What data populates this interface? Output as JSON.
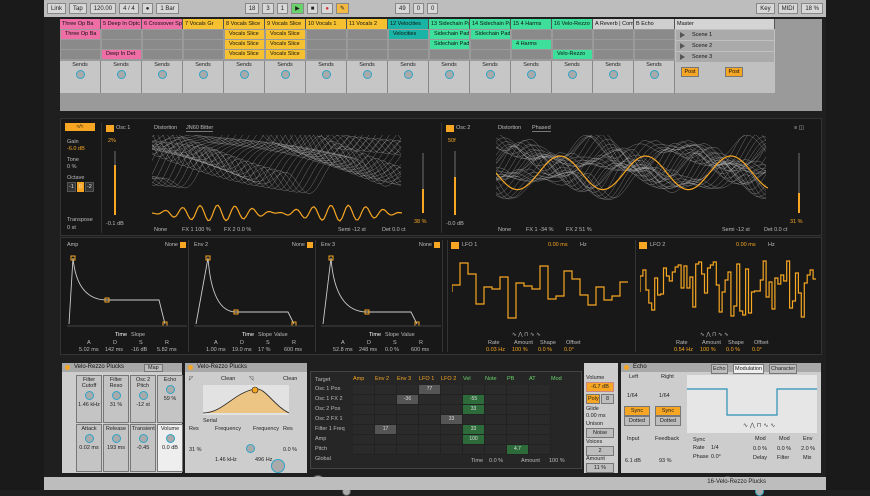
{
  "transport": {
    "link": "Link",
    "tap": "Tap",
    "tempo": "120.00",
    "sig": "4 / 4",
    "quant": "1 Bar",
    "bar": "18",
    "beat": "3",
    "beat2": "1",
    "pos": "49",
    "pos2": "0",
    "pos3": "0",
    "key": "Key",
    "midi": "MIDI",
    "cpu": "18 %"
  },
  "tracks": [
    {
      "name": "Three Op Ba",
      "color": "#f06ea6",
      "clips": [
        {
          "t": "Three Op Ba",
          "c": "#f06ea6"
        },
        {
          "t": "",
          "c": ""
        },
        {
          "t": "",
          "c": ""
        }
      ]
    },
    {
      "name": "5 Deep In Optc",
      "color": "#f06ea6",
      "clips": [
        {
          "t": "",
          "c": ""
        },
        {
          "t": "",
          "c": ""
        },
        {
          "t": "Deep In Det",
          "c": "#f06ea6"
        }
      ]
    },
    {
      "name": "6 Crossover Sp",
      "color": "#f06ea6",
      "clips": [
        {
          "t": "",
          "c": ""
        },
        {
          "t": "",
          "c": ""
        },
        {
          "t": "",
          "c": ""
        }
      ]
    },
    {
      "name": "7 Vocals Gr",
      "color": "#f6c130",
      "clips": [
        {
          "t": "",
          "c": ""
        },
        {
          "t": "",
          "c": ""
        },
        {
          "t": "",
          "c": ""
        }
      ]
    },
    {
      "name": "8 Vocals Slice",
      "color": "#f6c130",
      "clips": [
        {
          "t": "Vocals Slice",
          "c": "#f6c130"
        },
        {
          "t": "Vocals Slice",
          "c": "#f6c130"
        },
        {
          "t": "Vocals Slice",
          "c": "#f6c130"
        }
      ]
    },
    {
      "name": "9 Vocals Slice",
      "color": "#f6c130",
      "clips": [
        {
          "t": "Vocals Slice",
          "c": "#f6c130"
        },
        {
          "t": "Vocals Slice",
          "c": "#f6c130"
        },
        {
          "t": "Vocals Slice",
          "c": "#f6c130"
        }
      ]
    },
    {
      "name": "10 Vocals 1",
      "color": "#f6c130",
      "clips": [
        {
          "t": "",
          "c": ""
        },
        {
          "t": "",
          "c": ""
        },
        {
          "t": "",
          "c": ""
        }
      ]
    },
    {
      "name": "11 Vocals 2",
      "color": "#f6c130",
      "clips": [
        {
          "t": "",
          "c": ""
        },
        {
          "t": "",
          "c": ""
        },
        {
          "t": "",
          "c": ""
        }
      ]
    },
    {
      "name": "12 Velocities",
      "color": "#19b4a6",
      "clips": [
        {
          "t": "Velocities",
          "c": "#19b4a6"
        },
        {
          "t": "",
          "c": ""
        },
        {
          "t": "",
          "c": ""
        }
      ]
    },
    {
      "name": "13 Sidechain Pad",
      "color": "#3ddf9a",
      "clips": [
        {
          "t": "Sidechain Pad",
          "c": "#3ddf9a"
        },
        {
          "t": "Sidechain Pad",
          "c": "#3ddf9a"
        },
        {
          "t": "",
          "c": ""
        }
      ]
    },
    {
      "name": "14 Sidechain Pad",
      "color": "#3ddf9a",
      "clips": [
        {
          "t": "Sidechain Pad",
          "c": "#3ddf9a"
        },
        {
          "t": "",
          "c": ""
        },
        {
          "t": "",
          "c": ""
        }
      ]
    },
    {
      "name": "15 4 Harms",
      "color": "#3ddf9a",
      "clips": [
        {
          "t": "",
          "c": ""
        },
        {
          "t": "4 Harms",
          "c": "#3ddf9a"
        },
        {
          "t": "",
          "c": ""
        }
      ]
    },
    {
      "name": "16 Velo-Rezzo",
      "color": "#3ddf9a",
      "clips": [
        {
          "t": "",
          "c": ""
        },
        {
          "t": "",
          "c": ""
        },
        {
          "t": "Velo-Rezzo",
          "c": "#3ddf9a"
        }
      ]
    },
    {
      "name": "A Reverb | Compre",
      "color": "#cfcfcf",
      "clips": [
        {
          "t": "",
          "c": ""
        },
        {
          "t": "",
          "c": ""
        },
        {
          "t": "",
          "c": ""
        }
      ]
    },
    {
      "name": "B Echo",
      "color": "#cfcfcf",
      "clips": [
        {
          "t": "",
          "c": ""
        },
        {
          "t": "",
          "c": ""
        },
        {
          "t": "",
          "c": ""
        }
      ]
    }
  ],
  "master": {
    "name": "Master",
    "scenes": [
      "Scene 1",
      "Scene 2",
      "Scene 3"
    ],
    "post1": "Post",
    "post2": "Post"
  },
  "sends_label": "Sends",
  "osc1": {
    "label": "Osc 1",
    "dist_label": "Distortion",
    "dist_val": "JN60 Bitter",
    "gain_label": "Gain",
    "gain": "-6.0 dB",
    "tone_label": "Tone",
    "tone": "0 %",
    "octave_label": "Octave",
    "oct": [
      "-1",
      "0",
      "-2"
    ],
    "transpose_label": "Transpose",
    "transpose": "0 st",
    "level": "2%",
    "db": "-0.1 dB",
    "fx1": "FX 1 100 %",
    "fx2": "FX 2 0.0 %",
    "none": "None",
    "semi": "Semi -12 st",
    "det": "Det 0.0 ct",
    "pct": "38 %"
  },
  "osc2": {
    "label": "Osc 2",
    "dist_label": "Distortion",
    "dist_val": "Phased",
    "level": "50f",
    "db": "-0.0 dB",
    "fx1": "FX 1 -34 %",
    "fx2": "FX 2 51 %",
    "none": "None",
    "semi": "Semi -12 st",
    "det": "Det 0.0 ct",
    "pct": "31 %"
  },
  "env": [
    {
      "name": "Amp",
      "mode": "None",
      "time": "Time",
      "slope": "Slope",
      "a": "5.02 ms",
      "d": "142 ms",
      "s": "-16 dB",
      "r": "5.82 ms"
    },
    {
      "name": "Env 2",
      "mode": "None",
      "time": "Time",
      "slope": "Slope",
      "value": "Value",
      "a": "1.00 ms",
      "d": "19.0 ms",
      "s": "17 %",
      "r": "600 ms"
    },
    {
      "name": "Env 3",
      "mode": "None",
      "time": "Time",
      "slope": "Slope",
      "value": "Value",
      "a": "52.8 ms",
      "d": "248 ms",
      "s": "0.0 %",
      "r": "600 ms"
    }
  ],
  "adsr_labels": [
    "A",
    "D",
    "S",
    "R"
  ],
  "lfo": [
    {
      "name": "LFO 1",
      "a": "0.00 ms",
      "hz": "Hz",
      "rate": "0.03 Hz",
      "amount": "100 %",
      "shape": "0.0 %",
      "offset": "0.0°",
      "rl": "Rate",
      "al": "Amount",
      "sl": "Shape",
      "ol": "Offset"
    },
    {
      "name": "LFO 2",
      "a": "0.00 ms",
      "hz": "Hz",
      "rate": "0.54 Hz",
      "amount": "100 %",
      "shape": "0.0 %",
      "offset": "0.0°",
      "rl": "Rate",
      "al": "Amount",
      "sl": "Shape",
      "ol": "Offset"
    }
  ],
  "rack": {
    "title": "Velo-Rezzo Plucks",
    "map": "Map",
    "macros": [
      {
        "l": "Filter Cutoff",
        "v": "1.46 kHz"
      },
      {
        "l": "Filter Reso",
        "v": "31 %"
      },
      {
        "l": "Osc 2 Pitch",
        "v": "-12 st"
      },
      {
        "l": "Echo",
        "v": "59 %"
      },
      {
        "l": "Attack",
        "v": "0.02 ms"
      },
      {
        "l": "Release",
        "v": "193 ms"
      },
      {
        "l": "Transient",
        "v": "-0.45"
      },
      {
        "l": "Volume",
        "v": "0.0 dB"
      }
    ]
  },
  "filter": {
    "title": "Velo-Rezzo Plucks",
    "clean1": "Clean",
    "clean2": "Clean",
    "serial": "Serial",
    "res_label": "Res",
    "res": "31 %",
    "freq_label": "Frequency",
    "freq": "1.46 kHz",
    "freq2_label": "Frequency",
    "freq2": "496 Hz",
    "res2_label": "Res",
    "res2": "0.0 %"
  },
  "matrix": {
    "target": "Target",
    "cols": [
      "Amp",
      "Env 2",
      "Env 3",
      "LFO 1",
      "LFO 2",
      "Vel",
      "Note",
      "PB",
      "AT",
      "Mod"
    ],
    "rows": [
      "Osc 1 Pos",
      "Osc 1 FX 2",
      "Osc 2 Pos",
      "Osc 2 FX 1",
      "Filter 1 Freq",
      "Amp",
      "Pitch",
      "Global"
    ],
    "vals": [
      {
        "r": 0,
        "c": 3,
        "v": "77"
      },
      {
        "r": 1,
        "c": 2,
        "v": "-36"
      },
      {
        "r": 1,
        "c": 5,
        "v": "-55"
      },
      {
        "r": 2,
        "c": 5,
        "v": "33"
      },
      {
        "r": 3,
        "c": 4,
        "v": "33"
      },
      {
        "r": 4,
        "c": 1,
        "v": "17"
      },
      {
        "r": 4,
        "c": 5,
        "v": "33"
      },
      {
        "r": 5,
        "c": 5,
        "v": "100"
      },
      {
        "r": 6,
        "c": 7,
        "v": "4.7"
      }
    ],
    "time_label": "Time",
    "time": "0.0 %",
    "amount_label": "Amount",
    "amount": "100 %"
  },
  "volume": {
    "label": "Volume",
    "val": "-6.7 dB",
    "poly": "Poly",
    "count": "8",
    "glide_label": "Glide",
    "glide": "0.00 ms",
    "unison_label": "Unison",
    "unison": "Noise",
    "voices_label": "Voices",
    "voices": "2",
    "amount_label": "Amount",
    "amount": "11 %"
  },
  "echo": {
    "title": "Echo",
    "tab1": "Echo",
    "tab2": "Modulation",
    "tab3": "Character",
    "left_label": "Left",
    "left": "1/64",
    "right_label": "Right",
    "right": "1/64",
    "sync": "Sync",
    "sync2": "Sync",
    "dotted": "Dotted",
    "dotted2": "Dotted",
    "input_label": "Input",
    "input": "6.1 dB",
    "feedback_label": "Feedback",
    "feedback": "93 %",
    "sync3": "Sync",
    "rate_label": "Rate",
    "rate": "1/4",
    "phase_label": "Phase",
    "phase": "0.0°",
    "mod_label": "Mod",
    "mod": "0.0 %",
    "delay_label": "Delay",
    "mod2_label": "Mod",
    "mod2": "0.0 %",
    "filter_label": "Filter",
    "env_label": "Env",
    "env": "2.0 %",
    "mix_label": "Mix"
  },
  "status": "16-Velo-Rezzo Plucks"
}
